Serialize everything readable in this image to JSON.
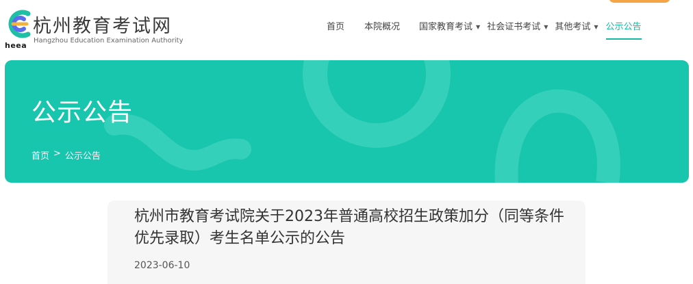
{
  "brand": {
    "mark_text": "heea",
    "name_cn": "杭州教育考试网",
    "name_en": "Hangzhou Education Examination Authority"
  },
  "nav": {
    "items": [
      {
        "label": "首页",
        "dropdown": false,
        "active": false
      },
      {
        "label": "本院概况",
        "dropdown": false,
        "active": false
      },
      {
        "label": "国家教育考试",
        "dropdown": true,
        "active": false
      },
      {
        "label": "社会证书考试",
        "dropdown": true,
        "active": false
      },
      {
        "label": "其他考试",
        "dropdown": true,
        "active": false
      },
      {
        "label": "公示公告",
        "dropdown": false,
        "active": true
      }
    ],
    "caret": "▼"
  },
  "banner": {
    "title": "公示公告",
    "breadcrumb": {
      "home": "首页",
      "separator": ">",
      "current": "公示公告"
    }
  },
  "article": {
    "title": "杭州市教育考试院关于2023年普通高校招生政策加分（同等条件优先录取）考生名单公示的公告",
    "date": "2023-06-10"
  },
  "colors": {
    "accent": "#18c5ad",
    "active_nav": "#14b8a0",
    "top_tab": "#f5a446"
  }
}
